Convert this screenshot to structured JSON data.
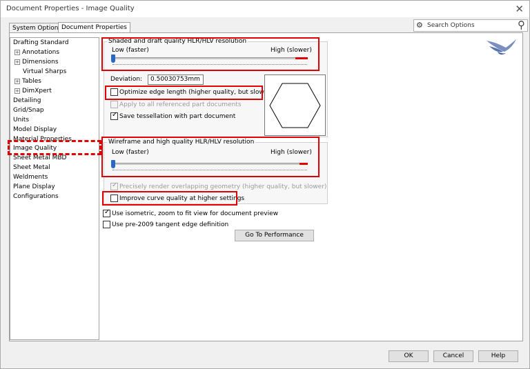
{
  "window": {
    "title": "Document Properties - Image Quality"
  },
  "tabs": [
    {
      "label": "System Options"
    },
    {
      "label": "Document Properties"
    }
  ],
  "search": {
    "placeholder": "Search Options"
  },
  "tree": [
    {
      "label": "Drafting Standard"
    },
    {
      "label": "Annotations"
    },
    {
      "label": "Dimensions"
    },
    {
      "label": "Virtual Sharps"
    },
    {
      "label": "Tables"
    },
    {
      "label": "DimXpert"
    },
    {
      "label": "Detailing"
    },
    {
      "label": "Grid/Snap"
    },
    {
      "label": "Units"
    },
    {
      "label": "Model Display"
    },
    {
      "label": "Material Properties"
    },
    {
      "label": "Image Quality"
    },
    {
      "label": "Sheet Metal MBD"
    },
    {
      "label": "Sheet Metal"
    },
    {
      "label": "Weldments"
    },
    {
      "label": "Plane Display"
    },
    {
      "label": "Configurations"
    }
  ],
  "shaded": {
    "title": "Shaded and draft quality HLR/HLV resolution",
    "low": "Low (faster)",
    "high": "High (slower)",
    "slider_level": 0.0,
    "deviation_label": "Deviation:",
    "deviation_value": "0.50030753mm",
    "optimize": "Optimize edge length (higher quality, but slower)",
    "optimize_checked": false,
    "apply_all": "Apply to all referenced part documents",
    "apply_all_checked": false,
    "save_tess": "Save tessellation with part document",
    "save_tess_checked": true
  },
  "wireframe": {
    "title": "Wireframe and high quality HLR/HLV resolution",
    "low": "Low (faster)",
    "high": "High (slower)",
    "slider_level": 0.0,
    "precise": "Precisely render overlapping geometry (higher quality, but slower)",
    "precise_checked": true,
    "improve": "Improve curve quality at higher settings",
    "improve_checked": false
  },
  "options": {
    "isometric": "Use isometric, zoom to fit view for document preview",
    "isometric_checked": true,
    "pre2009": "Use pre-2009 tangent edge definition",
    "pre2009_checked": false
  },
  "buttons": {
    "performance": "Go To Performance",
    "ok": "OK",
    "cancel": "Cancel",
    "help": "Help"
  }
}
